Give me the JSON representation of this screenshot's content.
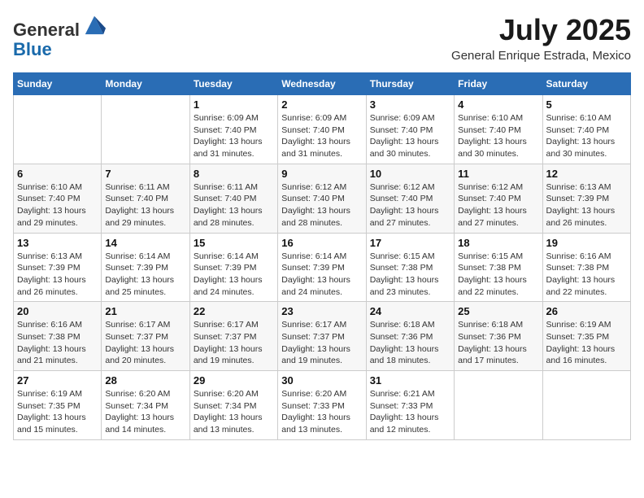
{
  "header": {
    "logo_general": "General",
    "logo_blue": "Blue",
    "month_title": "July 2025",
    "subtitle": "General Enrique Estrada, Mexico"
  },
  "days_of_week": [
    "Sunday",
    "Monday",
    "Tuesday",
    "Wednesday",
    "Thursday",
    "Friday",
    "Saturday"
  ],
  "weeks": [
    [
      {
        "day": "",
        "info": ""
      },
      {
        "day": "",
        "info": ""
      },
      {
        "day": "1",
        "info": "Sunrise: 6:09 AM\nSunset: 7:40 PM\nDaylight: 13 hours\nand 31 minutes."
      },
      {
        "day": "2",
        "info": "Sunrise: 6:09 AM\nSunset: 7:40 PM\nDaylight: 13 hours\nand 31 minutes."
      },
      {
        "day": "3",
        "info": "Sunrise: 6:09 AM\nSunset: 7:40 PM\nDaylight: 13 hours\nand 30 minutes."
      },
      {
        "day": "4",
        "info": "Sunrise: 6:10 AM\nSunset: 7:40 PM\nDaylight: 13 hours\nand 30 minutes."
      },
      {
        "day": "5",
        "info": "Sunrise: 6:10 AM\nSunset: 7:40 PM\nDaylight: 13 hours\nand 30 minutes."
      }
    ],
    [
      {
        "day": "6",
        "info": "Sunrise: 6:10 AM\nSunset: 7:40 PM\nDaylight: 13 hours\nand 29 minutes."
      },
      {
        "day": "7",
        "info": "Sunrise: 6:11 AM\nSunset: 7:40 PM\nDaylight: 13 hours\nand 29 minutes."
      },
      {
        "day": "8",
        "info": "Sunrise: 6:11 AM\nSunset: 7:40 PM\nDaylight: 13 hours\nand 28 minutes."
      },
      {
        "day": "9",
        "info": "Sunrise: 6:12 AM\nSunset: 7:40 PM\nDaylight: 13 hours\nand 28 minutes."
      },
      {
        "day": "10",
        "info": "Sunrise: 6:12 AM\nSunset: 7:40 PM\nDaylight: 13 hours\nand 27 minutes."
      },
      {
        "day": "11",
        "info": "Sunrise: 6:12 AM\nSunset: 7:40 PM\nDaylight: 13 hours\nand 27 minutes."
      },
      {
        "day": "12",
        "info": "Sunrise: 6:13 AM\nSunset: 7:39 PM\nDaylight: 13 hours\nand 26 minutes."
      }
    ],
    [
      {
        "day": "13",
        "info": "Sunrise: 6:13 AM\nSunset: 7:39 PM\nDaylight: 13 hours\nand 26 minutes."
      },
      {
        "day": "14",
        "info": "Sunrise: 6:14 AM\nSunset: 7:39 PM\nDaylight: 13 hours\nand 25 minutes."
      },
      {
        "day": "15",
        "info": "Sunrise: 6:14 AM\nSunset: 7:39 PM\nDaylight: 13 hours\nand 24 minutes."
      },
      {
        "day": "16",
        "info": "Sunrise: 6:14 AM\nSunset: 7:39 PM\nDaylight: 13 hours\nand 24 minutes."
      },
      {
        "day": "17",
        "info": "Sunrise: 6:15 AM\nSunset: 7:38 PM\nDaylight: 13 hours\nand 23 minutes."
      },
      {
        "day": "18",
        "info": "Sunrise: 6:15 AM\nSunset: 7:38 PM\nDaylight: 13 hours\nand 22 minutes."
      },
      {
        "day": "19",
        "info": "Sunrise: 6:16 AM\nSunset: 7:38 PM\nDaylight: 13 hours\nand 22 minutes."
      }
    ],
    [
      {
        "day": "20",
        "info": "Sunrise: 6:16 AM\nSunset: 7:38 PM\nDaylight: 13 hours\nand 21 minutes."
      },
      {
        "day": "21",
        "info": "Sunrise: 6:17 AM\nSunset: 7:37 PM\nDaylight: 13 hours\nand 20 minutes."
      },
      {
        "day": "22",
        "info": "Sunrise: 6:17 AM\nSunset: 7:37 PM\nDaylight: 13 hours\nand 19 minutes."
      },
      {
        "day": "23",
        "info": "Sunrise: 6:17 AM\nSunset: 7:37 PM\nDaylight: 13 hours\nand 19 minutes."
      },
      {
        "day": "24",
        "info": "Sunrise: 6:18 AM\nSunset: 7:36 PM\nDaylight: 13 hours\nand 18 minutes."
      },
      {
        "day": "25",
        "info": "Sunrise: 6:18 AM\nSunset: 7:36 PM\nDaylight: 13 hours\nand 17 minutes."
      },
      {
        "day": "26",
        "info": "Sunrise: 6:19 AM\nSunset: 7:35 PM\nDaylight: 13 hours\nand 16 minutes."
      }
    ],
    [
      {
        "day": "27",
        "info": "Sunrise: 6:19 AM\nSunset: 7:35 PM\nDaylight: 13 hours\nand 15 minutes."
      },
      {
        "day": "28",
        "info": "Sunrise: 6:20 AM\nSunset: 7:34 PM\nDaylight: 13 hours\nand 14 minutes."
      },
      {
        "day": "29",
        "info": "Sunrise: 6:20 AM\nSunset: 7:34 PM\nDaylight: 13 hours\nand 13 minutes."
      },
      {
        "day": "30",
        "info": "Sunrise: 6:20 AM\nSunset: 7:33 PM\nDaylight: 13 hours\nand 13 minutes."
      },
      {
        "day": "31",
        "info": "Sunrise: 6:21 AM\nSunset: 7:33 PM\nDaylight: 13 hours\nand 12 minutes."
      },
      {
        "day": "",
        "info": ""
      },
      {
        "day": "",
        "info": ""
      }
    ]
  ]
}
